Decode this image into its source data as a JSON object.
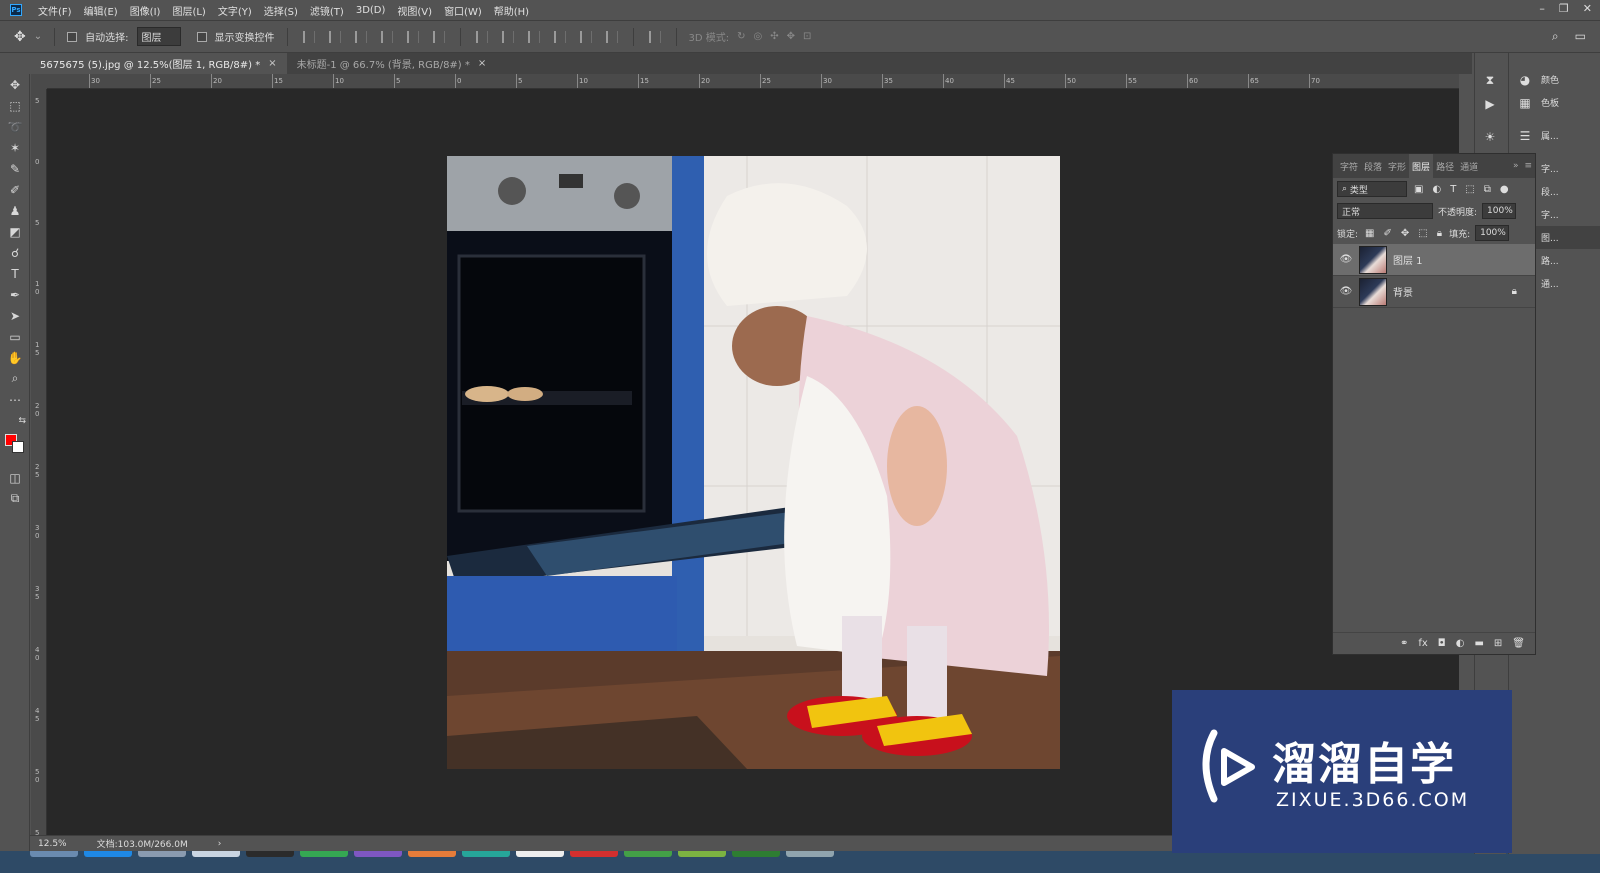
{
  "menubar": {
    "logo": "Ps",
    "items": [
      "文件(F)",
      "编辑(E)",
      "图像(I)",
      "图层(L)",
      "文字(Y)",
      "选择(S)",
      "滤镜(T)",
      "3D(D)",
      "视图(V)",
      "窗口(W)",
      "帮助(H)"
    ]
  },
  "optbar": {
    "auto_select_label": "自动选择:",
    "auto_select_value": "图层",
    "show_transform_label": "显示变换控件",
    "mode_3d_label": "3D 模式:"
  },
  "tabs": [
    {
      "label": "5675675 (5).jpg @ 12.5%(图层 1, RGB/8#) *",
      "active": true
    },
    {
      "label": "未标题-1 @ 66.7% (背景, RGB/8#) *",
      "active": false
    }
  ],
  "ruler_top": [
    "30",
    "25",
    "20",
    "15",
    "10",
    "5",
    "0",
    "5",
    "10",
    "15",
    "20",
    "25",
    "30",
    "35",
    "40",
    "45",
    "50",
    "55",
    "60",
    "65",
    "70"
  ],
  "ruler_left": [
    "5",
    "0",
    "5",
    "1 0",
    "1 5",
    "2 0",
    "2 5",
    "3 0",
    "3 5",
    "4 0",
    "4 5",
    "5 0",
    "5 5"
  ],
  "status": {
    "zoom": "12.5%",
    "doc": "文档:103.0M/266.0M"
  },
  "colors": {
    "foreground": "#ff0000",
    "background": "#ffffff"
  },
  "dock": {
    "items": [
      {
        "icon": "color-icon",
        "label": "颜色"
      },
      {
        "icon": "swatches-icon",
        "label": "色板"
      },
      {
        "icon": "properties-icon",
        "label": "属..."
      },
      {
        "icon": "character-icon",
        "label": "字..."
      },
      {
        "icon": "paragraph-icon",
        "label": "段..."
      },
      {
        "icon": "glyphs-icon",
        "label": "字..."
      },
      {
        "icon": "layers-icon",
        "label": "图..."
      },
      {
        "icon": "paths-icon",
        "label": "路..."
      },
      {
        "icon": "channels-icon",
        "label": "通..."
      }
    ]
  },
  "layers_panel": {
    "tabs": [
      "字符",
      "段落",
      "字形",
      "图层",
      "路径",
      "通道"
    ],
    "filter_label": "类型",
    "blend_mode": "正常",
    "opacity_label": "不透明度:",
    "opacity_value": "100%",
    "lock_label": "锁定:",
    "fill_label": "填充:",
    "fill_value": "100%",
    "layers": [
      {
        "name": "图层 1",
        "selected": true,
        "locked": false
      },
      {
        "name": "背景",
        "selected": false,
        "locked": true
      }
    ]
  },
  "watermark": {
    "title": "溜溜自学",
    "url": "ZIXUE.3D66.COM"
  }
}
